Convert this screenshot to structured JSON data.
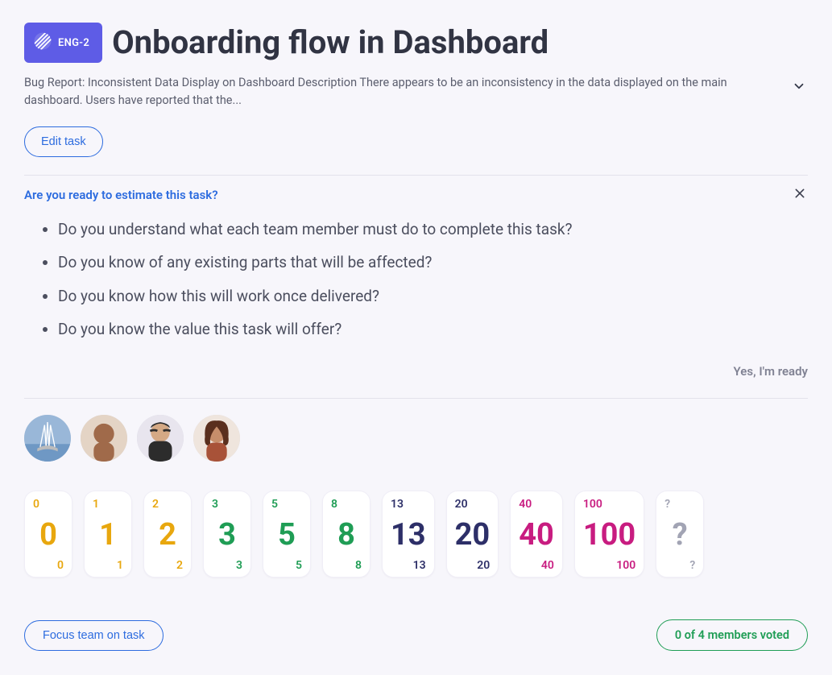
{
  "header": {
    "badge_label": "ENG-2",
    "title": "Onboarding flow in Dashboard",
    "description": "Bug Report: Inconsistent Data Display on Dashboard Description There appears to be an inconsistency in the data displayed on the main dashboard. Users have reported that the...",
    "edit_label": "Edit task"
  },
  "ready": {
    "prompt": "Are you ready to estimate this task?",
    "questions": [
      "Do you understand what each team member must do to complete this task?",
      "Do you know of any existing parts that will be affected?",
      "Do you know how this will work once delivered?",
      "Do you know the value this task will offer?"
    ],
    "ready_label": "Yes, I'm ready"
  },
  "members": [
    {
      "name": "member-1"
    },
    {
      "name": "member-2"
    },
    {
      "name": "member-3"
    },
    {
      "name": "member-4"
    }
  ],
  "cards": [
    {
      "label": "0",
      "color": "yellow"
    },
    {
      "label": "1",
      "color": "yellow"
    },
    {
      "label": "2",
      "color": "yellow"
    },
    {
      "label": "3",
      "color": "green"
    },
    {
      "label": "5",
      "color": "green"
    },
    {
      "label": "8",
      "color": "green"
    },
    {
      "label": "13",
      "color": "navy"
    },
    {
      "label": "20",
      "color": "navy"
    },
    {
      "label": "40",
      "color": "pink"
    },
    {
      "label": "100",
      "color": "pink"
    },
    {
      "label": "?",
      "color": "gray"
    }
  ],
  "footer": {
    "focus_label": "Focus team on task",
    "vote_status": "0 of 4 members voted"
  }
}
